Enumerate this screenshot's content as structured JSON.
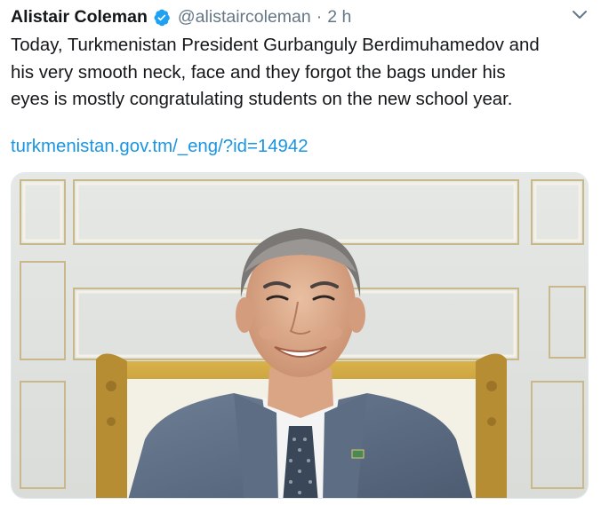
{
  "tweet": {
    "author_name": "Alistair Coleman",
    "handle": "@alistaircoleman",
    "separator": "·",
    "timestamp": "2 h",
    "verified": true,
    "text": "Today, Turkmenistan President Gurbanguly Berdimuhamedov and\nhis very smooth neck, face and they forgot the bags under his\neyes is mostly congratulating students on the new school year.",
    "link": "turkmenistan.gov.tm/_eng/?id=14942",
    "icons": {
      "verified": "verified-badge-icon",
      "menu": "chevron-down-icon"
    },
    "colors": {
      "link": "#1b95e0",
      "verified": "#1da1f2",
      "secondary_text": "#657786"
    }
  }
}
